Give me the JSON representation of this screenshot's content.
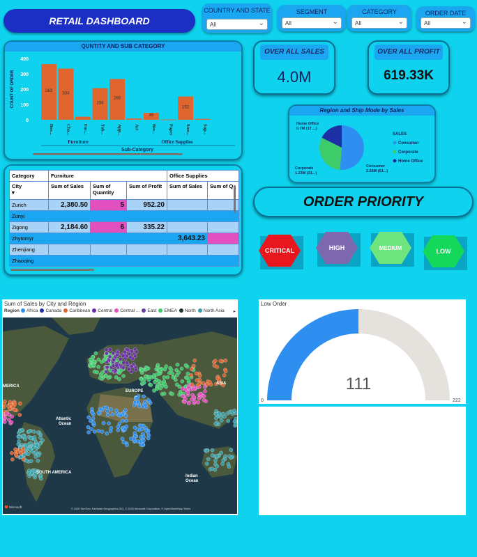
{
  "header": {
    "title": "RETAIL DASHBOARD"
  },
  "slicers": [
    {
      "label": "COUNTRY AND STATE",
      "value": "All"
    },
    {
      "label": "SEGMENT",
      "value": "All"
    },
    {
      "label": "CATEGORY",
      "value": "All"
    },
    {
      "label": "ORDER DATE",
      "value": "All"
    }
  ],
  "bar_chart": {
    "title": "QUNTITY AND SUB CATEGORY",
    "ylabel": "COUNT OF ORDER",
    "xlabel": "Sub-Category",
    "groups": [
      "Furniture",
      "Office Supplies"
    ],
    "ticks": [
      "400",
      "300",
      "200",
      "100",
      "0"
    ]
  },
  "chart_data": [
    {
      "type": "bar",
      "title": "QUNTITY AND SUB CATEGORY",
      "xlabel": "Sub-Category",
      "ylabel": "COUNT OF ORDER",
      "ylim": [
        0,
        400
      ],
      "categories": [
        "Boo...",
        "Cha...",
        "Fur...",
        "Tab...",
        "App...",
        "Art",
        "Bin...",
        "Paper",
        "Stor...",
        "Sup..."
      ],
      "values": [
        363,
        334,
        20,
        206,
        266,
        8,
        45,
        2,
        152,
        6
      ],
      "labels": [
        "363",
        "334",
        "",
        "206",
        "266",
        "",
        "45",
        "",
        "152",
        ""
      ],
      "color": "#e0652f"
    },
    {
      "type": "pie",
      "title": "Region and Ship Mode by Sales",
      "legend_title": "SALES",
      "categories": [
        "Consumer",
        "Corporate",
        "Home Office"
      ],
      "values": [
        2.03,
        1.23,
        0.7
      ],
      "colors": [
        "#2e8ff0",
        "#3ecb6a",
        "#1d2fa5"
      ],
      "labels": [
        "Consumer 2.03M (51...)",
        "Corporate 1.23M (31...)",
        "Home Office 0.7M (17....)"
      ]
    },
    {
      "type": "gauge",
      "title": "Low Order",
      "value": 111,
      "min": 0,
      "max": 222,
      "colors": [
        "#2e8ff0",
        "#e5e1dd"
      ]
    }
  ],
  "kpis": {
    "sales": {
      "title": "OVER ALL  SALES",
      "value": "4.0M"
    },
    "profit": {
      "title": "OVER ALL PROFIT",
      "value": "619.33K"
    }
  },
  "pie": {
    "title": "Region and Ship Mode by Sales",
    "legend_title": "SALES",
    "legend": [
      "Consumer",
      "Corporate",
      "Home Office"
    ],
    "labels": {
      "home_office": "Home Office\n0.7M (17....)",
      "home_office_1": "Home Office",
      "home_office_2": "0.7M (17....)",
      "corporate_1": "Corporate",
      "corporate_2": "1.23M (31...)",
      "consumer_1": "Consumer",
      "consumer_2": "2.03M (51...)"
    }
  },
  "table": {
    "header_row": {
      "category": "Category",
      "furniture": "Furniture",
      "office": "Office Supplies"
    },
    "columns": [
      "City",
      "Sum of Sales",
      "Sum of Quantity",
      "Sum of Profit",
      "Sum of Sales",
      "Sum of Q"
    ],
    "rows": [
      {
        "city": "Zurich",
        "sales": "2,380.50",
        "qty": "5",
        "profit": "952.20",
        "sales2": "",
        "q2": ""
      },
      {
        "city": "Zunyi",
        "sales": "",
        "qty": "",
        "profit": "",
        "sales2": "",
        "q2": ""
      },
      {
        "city": "Zigong",
        "sales": "2,184.60",
        "qty": "6",
        "profit": "335.22",
        "sales2": "",
        "q2": ""
      },
      {
        "city": "Zhytomyr",
        "sales": "",
        "qty": "",
        "profit": "",
        "sales2": "3,643.23",
        "q2": ""
      },
      {
        "city": "Zhenjiang",
        "sales": "",
        "qty": "",
        "profit": "",
        "sales2": "",
        "q2": ""
      },
      {
        "city": "Zhaoqing",
        "sales": "",
        "qty": "",
        "profit": "",
        "sales2": "",
        "q2": ""
      }
    ]
  },
  "order_priority": {
    "title": "ORDER PRIORITY",
    "buttons": [
      {
        "label": "CRITICAL",
        "color": "#e8171f"
      },
      {
        "label": "HIGH",
        "color": "#7d68ad"
      },
      {
        "label": "MEDIUM",
        "color": "#6fe57f"
      },
      {
        "label": "LOW",
        "color": "#13d85a"
      }
    ]
  },
  "map": {
    "title": "Sum of Sales by City and Region",
    "legend_label": "Region",
    "regions": [
      {
        "name": "Africa",
        "color": "#2e8ff0"
      },
      {
        "name": "Canada",
        "color": "#1d2fa5"
      },
      {
        "name": "Caribbean",
        "color": "#e0652f"
      },
      {
        "name": "Central",
        "color": "#6b2fa5"
      },
      {
        "name": "Central ...",
        "color": "#e24fbe"
      },
      {
        "name": "East",
        "color": "#6b3fa0"
      },
      {
        "name": "EMEA",
        "color": "#3ecb6a"
      },
      {
        "name": "North",
        "color": "#1b3a2a"
      },
      {
        "name": "North Asia",
        "color": "#3aa0a8"
      }
    ],
    "places": {
      "america": "MERICA",
      "europe": "EUROPE",
      "asia": "ASIA",
      "atlantic": "Atlantic\nOcean",
      "atlantic_1": "Atlantic",
      "atlantic_2": "Ocean",
      "indian_1": "Indian",
      "indian_2": "Ocean",
      "south_america": "SOUTH AMERICA"
    },
    "attribution": "© 2025 TomTom, Earthstar Geographics SIO, © 2025 Microsoft Corporation, © OpenStreetMap  Terms",
    "brand": "Microsoft"
  },
  "gauge": {
    "title": "Low Order",
    "value": "111",
    "min": "0",
    "max": "222"
  }
}
